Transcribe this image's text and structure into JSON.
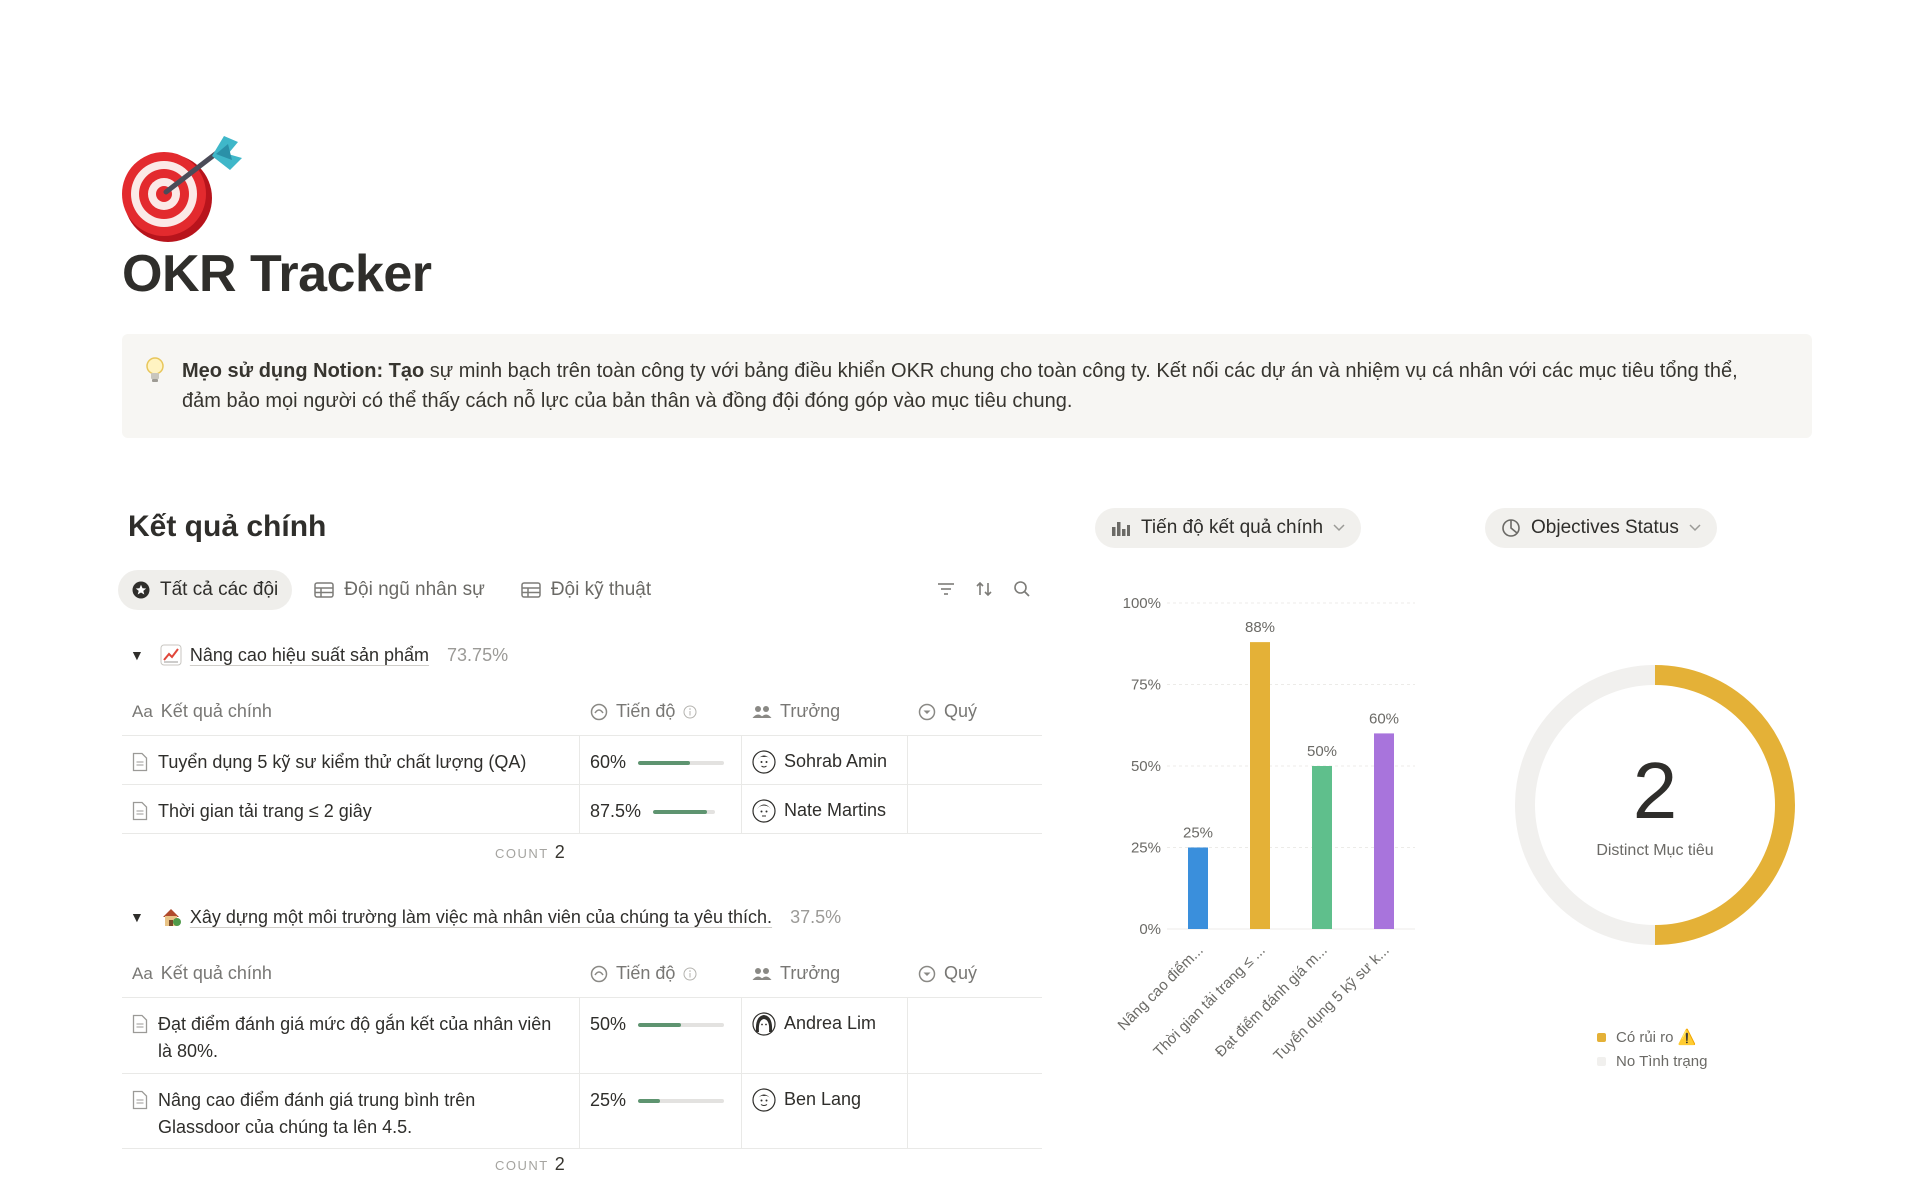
{
  "page": {
    "title": "OKR Tracker",
    "icon": "target-dart-icon"
  },
  "callout": {
    "icon": "lightbulb-icon",
    "bold": "Mẹo sử dụng Notion: Tạo",
    "text": " sự minh bạch trên toàn công ty với bảng điều khiển OKR chung cho toàn công ty. Kết nối các dự án và nhiệm vụ cá nhân với các mục tiêu tổng thể, đảm bảo mọi người có thể thấy cách nỗ lực của bản thân và đồng đội đóng góp vào mục tiêu chung."
  },
  "database": {
    "title": "Kết quả chính",
    "views": [
      {
        "label": "Tất cả các đội",
        "icon": "star-icon",
        "active": true
      },
      {
        "label": "Đội ngũ nhân sự",
        "icon": "table-icon",
        "active": false
      },
      {
        "label": "Đội kỹ thuật",
        "icon": "table-icon",
        "active": false
      }
    ],
    "tools": [
      "filter-icon",
      "sort-icon",
      "search-icon"
    ],
    "columns": {
      "name": "Kết quả chính",
      "name_icon": "Aa",
      "progress": "Tiến độ",
      "owner": "Trưởng",
      "quarter": "Quý"
    },
    "count_label": "COUNT",
    "groups": [
      {
        "emoji": "chart-increasing-icon",
        "name": "Nâng cao hiệu suất sản phẩm",
        "percent": "73.75%",
        "count": "2",
        "rows": [
          {
            "name": "Tuyển dụng 5 kỹ sư kiểm thử chất lượng (QA)",
            "progress_label": "60%",
            "progress": 0.6,
            "owner": "Sohrab Amin",
            "quarter": ""
          },
          {
            "name": "Thời gian tải trang ≤ 2 giây",
            "progress_label": "87.5%",
            "progress": 0.875,
            "owner": "Nate Martins",
            "quarter": ""
          }
        ]
      },
      {
        "emoji": "house-icon",
        "name": "Xây dựng một môi trường làm việc mà nhân viên của chúng ta yêu thích.",
        "percent": "37.5%",
        "count": "2",
        "rows": [
          {
            "name": "Đạt điểm đánh giá mức độ gắn kết của nhân viên là 80%.",
            "progress_label": "50%",
            "progress": 0.5,
            "owner": "Andrea Lim",
            "quarter": ""
          },
          {
            "name": "Nâng cao điểm đánh giá trung bình trên Glassdoor của chúng ta lên 4.5.",
            "progress_label": "25%",
            "progress": 0.25,
            "owner": "Ben Lang",
            "quarter": ""
          }
        ]
      }
    ]
  },
  "charts": {
    "bar_chip": "Tiến độ kết quả chính",
    "donut_chip": "Objectives Status"
  },
  "chart_data": [
    {
      "type": "bar",
      "title": "Tiến độ kết quả chính",
      "categories": [
        "Nâng cao điểm...",
        "Thời gian tải trang ≤ ...",
        "Đạt điểm đánh giá m...",
        "Tuyển dụng 5 kỹ sư k..."
      ],
      "values": [
        25,
        88,
        50,
        60
      ],
      "value_labels": [
        "25%",
        "88%",
        "50%",
        "60%"
      ],
      "colors": [
        "#3a8fdc",
        "#e4b137",
        "#5fbf8c",
        "#a874dc"
      ],
      "yticks": [
        "0%",
        "25%",
        "50%",
        "75%",
        "100%"
      ],
      "ylim": [
        0,
        100
      ],
      "grid": true
    },
    {
      "type": "pie",
      "title": "Objectives Status",
      "center_value": "2",
      "center_label": "Distinct Mục tiêu",
      "slices": [
        {
          "label": "Có rủi ro ⚠️",
          "value": 1,
          "color": "#e4b137"
        },
        {
          "label": "No Tình trạng",
          "value": 1,
          "color": "#f1f0ee"
        }
      ]
    }
  ]
}
